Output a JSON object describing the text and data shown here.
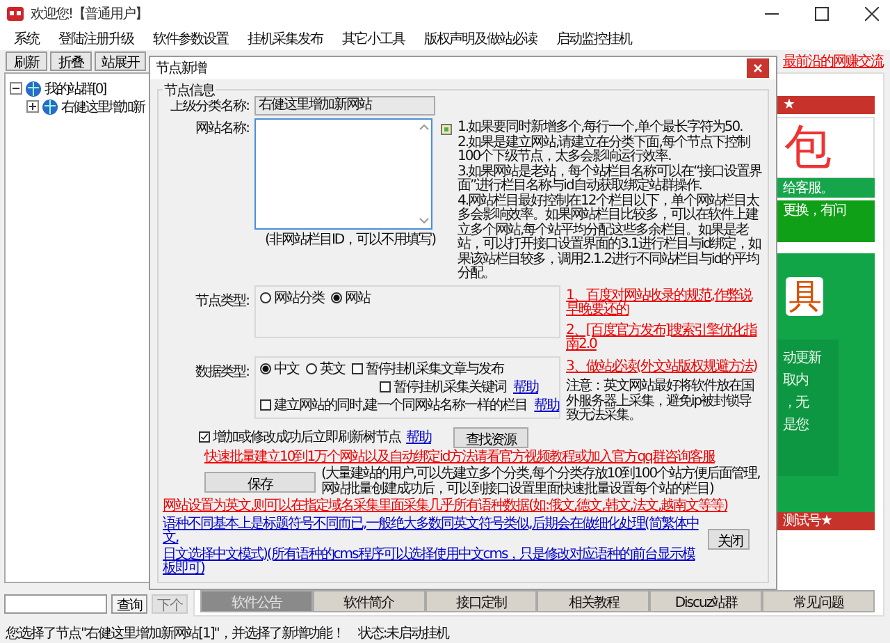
{
  "window": {
    "title": "欢迎您!【普通用户】"
  },
  "menu": [
    "系统",
    "登陆注册升级",
    "软件参数设置",
    "挂机采集发布",
    "其它小工具",
    "版权声明及做站必读",
    "启动监控挂机"
  ],
  "toolbar": {
    "buttons": [
      "刷新",
      "折叠",
      "站展开"
    ],
    "ticker": "最前沿的网赚交流"
  },
  "tree": [
    {
      "label": "我的站群[0]",
      "expanded": true,
      "children": [
        {
          "label": "右健这里增加新",
          "expanded": false
        }
      ]
    }
  ],
  "search": {
    "button": "查询",
    "next": {
      "label": "下个",
      "disabled": true
    }
  },
  "ads": [
    {
      "kind": "red_bar",
      "text": "★"
    },
    {
      "kind": "big_red",
      "text": "包"
    },
    {
      "kind": "green_line",
      "text": "给客服。"
    },
    {
      "kind": "green_box",
      "text": "更换，有问"
    },
    {
      "kind": "green_panel",
      "title": "具",
      "lines": [
        "动更新",
        "取内",
        "，无",
        "是您"
      ]
    },
    {
      "kind": "red_bar",
      "text": "测试号★"
    }
  ],
  "tabs": [
    {
      "label": "软件公告",
      "selected": true
    },
    {
      "label": "软件简介",
      "selected": false
    },
    {
      "label": "接口定制",
      "selected": false
    },
    {
      "label": "相关教程",
      "selected": false
    },
    {
      "label": "Discuz站群",
      "selected": false
    },
    {
      "label": "常见问题",
      "selected": false
    }
  ],
  "status_bar": {
    "message": "您选择了节点\"右健这里增加新网站[1]\"，并选择了新增功能！",
    "state": "状态:未启动挂机"
  },
  "dialog": {
    "title": "节点新增",
    "group": "节点信息",
    "parent": {
      "label": "上级分类名称:",
      "value": "右健这里增加新网站"
    },
    "name": {
      "label": "网站名称:"
    },
    "notes": [
      "1.如果要同时新增多个,每行一个,单个最长字符为50.",
      "2.如果是建立网站,请建立在分类下面,每个节点下控制100个下级节点，太多会影响运行效率.",
      "3.如果网站是老站，每个站栏目名称可以在“接口设置界面”进行栏目名称与id自动获取绑定站群操作.",
      "4.网站栏目最好控制在12个栏目以下，单个网站栏目太多会影响效率。如果网站栏目比较多，可以在软件上建立多个网站,每个站平均分配这些多余栏目。如果是老站，可以打开接口设置界面的3.1进行栏目与id绑定，如果该站栏目较多，调用2.1.2进行不同站栏目与id的平均分配。"
    ],
    "id_hint": "(非网站栏目ID，可以不用填写)",
    "node_type": {
      "label": "节点类型:",
      "options": [
        {
          "label": "网站分类",
          "selected": false
        },
        {
          "label": "网站",
          "selected": true
        }
      ]
    },
    "links_top": [
      "1、百度对网站收录的规范,作弊说早晚要还的",
      "2、[百度官方发布]搜索引擎优化指南2.0"
    ],
    "data_type": {
      "label": "数据类型:",
      "options": [
        {
          "label": "中文",
          "selected": true
        },
        {
          "label": "英文",
          "selected": false
        }
      ],
      "checks": [
        {
          "label": "暂停挂机采集文章与发布",
          "checked": false
        },
        {
          "label": "暂停挂机采集关键词",
          "checked": false,
          "help": "帮助"
        },
        {
          "label": "建立网站的同时,建一个同网站名称一样的栏目",
          "checked": false,
          "help": "帮助"
        }
      ]
    },
    "link_3": "3、做站必读(外文站版权规避方法)",
    "english_note": "注意：英文网站最好将软件放在国外服务器上采集，避免ip被封锁导致无法采集。",
    "refresh": {
      "label": "增加或修改成功后立即刷新树节点",
      "checked": true,
      "help": "帮助"
    },
    "find_button": "查找资源",
    "batch_link": "快速批量建立10到1万个网站以及自动绑定id方法请看官方视频教程或加入官方qq群咨询客服",
    "save_button": "保存",
    "save_note": "(大量建站的用户,可以先建立多个分类,每个分类存放10到100个站方便后面管理,网站批量创建成功后，可以到接口设置里面快速批量设置每个站的栏目)",
    "english_link": "网站设置为英文,则可以在指定域名采集里面采集几乎所有语种数据(如:俄文,德文,韩文,法文,越南文等等)",
    "language_note": [
      "语种不同基本上是标题符号不同而已,一般绝大多数同英文符号类似,后期会在做细化处理(简繁体中文,",
      "日文选择中文模式)(所有语种的cms程序可以选择使用中文cms，只是修改对应语种的前台显示模板即可)"
    ],
    "close_button": "关闭"
  }
}
